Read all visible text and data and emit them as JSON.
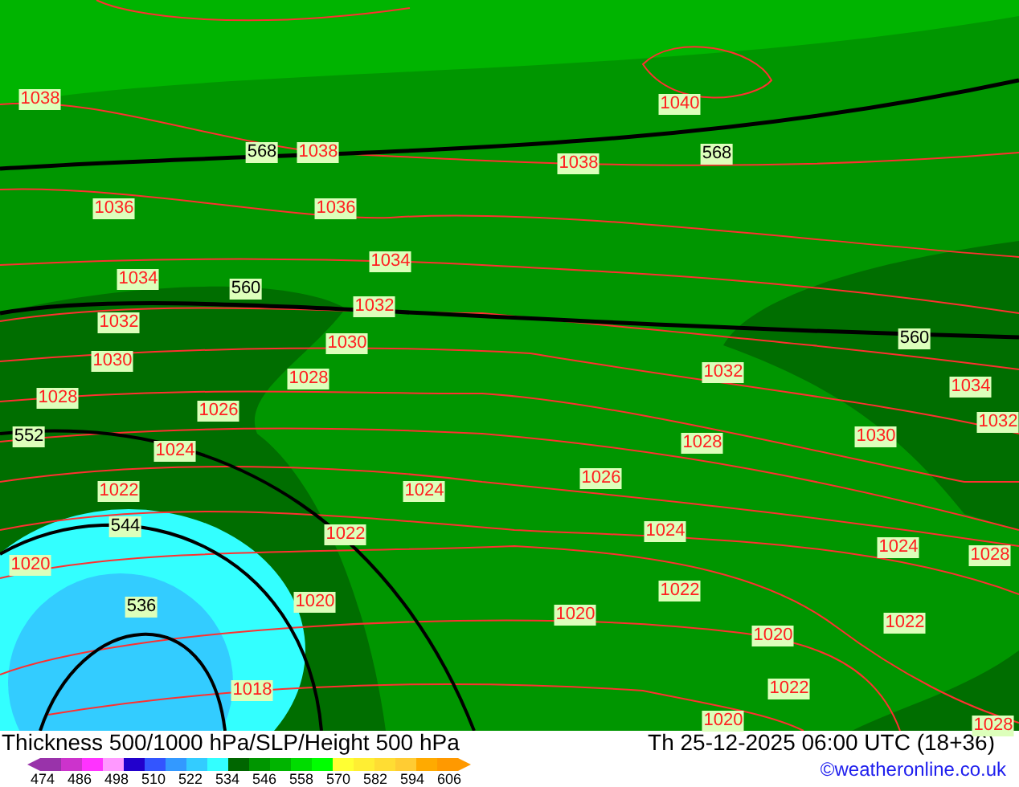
{
  "map": {
    "pressure_labels": [
      "1038",
      "1040",
      "1038",
      "1038",
      "1036",
      "1036",
      "1034",
      "1034",
      "1032",
      "1032",
      "1030",
      "1030",
      "1028",
      "1032",
      "1034",
      "1028",
      "1026",
      "1032",
      "1030",
      "1028",
      "1024",
      "1026",
      "1022",
      "1024",
      "1024",
      "1022",
      "1024",
      "1028",
      "1020",
      "1022",
      "1020",
      "1020",
      "1022",
      "1020",
      "1018",
      "1022",
      "1020",
      "1028"
    ],
    "thickness_labels": [
      "568",
      "568",
      "560",
      "560",
      "552",
      "544",
      "536"
    ]
  },
  "footer": {
    "title": "Thickness 500/1000 hPa/SLP/Height 500 hPa",
    "datetime": "Th 25-12-2025 06:00 UTC (18+36)",
    "credit": "©weatheronline.co.uk",
    "legend": {
      "swatches": [
        {
          "color": "#9933aa"
        },
        {
          "color": "#cc33cc"
        },
        {
          "color": "#ff33ff"
        },
        {
          "color": "#ff99ff"
        },
        {
          "color": "#2200cc"
        },
        {
          "color": "#3355ff"
        },
        {
          "color": "#3399ff"
        },
        {
          "color": "#33ccff"
        },
        {
          "color": "#33ffff"
        },
        {
          "color": "#006600"
        },
        {
          "color": "#009600"
        },
        {
          "color": "#00b400"
        },
        {
          "color": "#00dc00"
        },
        {
          "color": "#00ff00"
        },
        {
          "color": "#ffff33"
        },
        {
          "color": "#ffee33"
        },
        {
          "color": "#ffdd33"
        },
        {
          "color": "#ffcc33"
        },
        {
          "color": "#ffaa00"
        },
        {
          "color": "#ff9900"
        }
      ],
      "ticks": [
        "474",
        "486",
        "498",
        "510",
        "522",
        "534",
        "546",
        "558",
        "570",
        "582",
        "594",
        "606"
      ]
    }
  }
}
